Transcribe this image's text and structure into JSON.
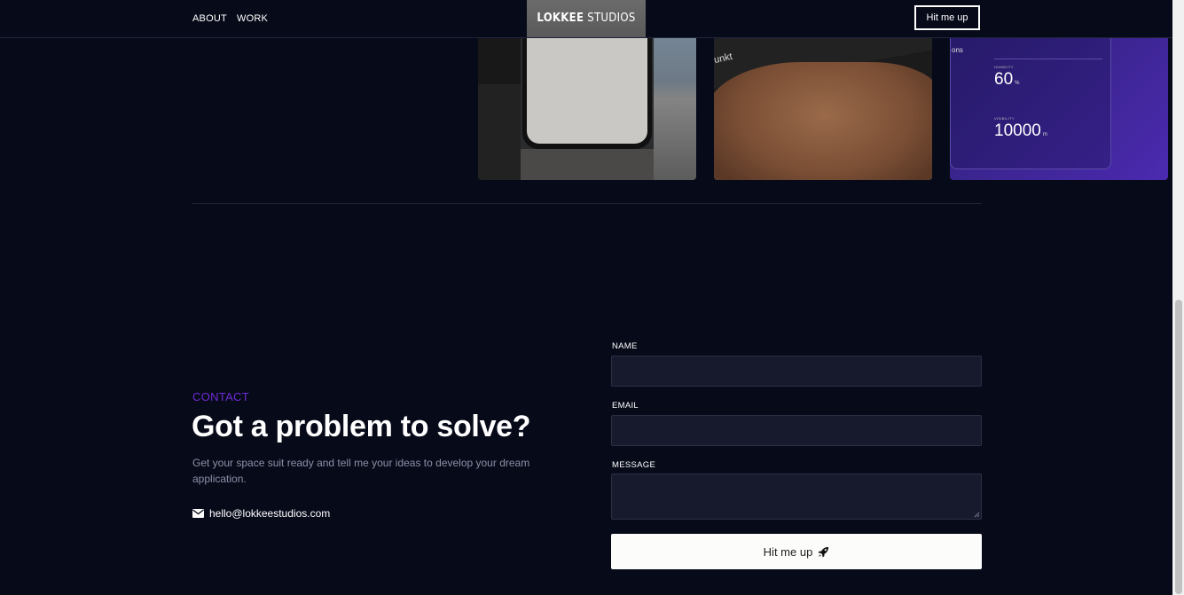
{
  "nav": {
    "links": [
      "ABOUT",
      "WORK"
    ],
    "brand_bold": "LOKKEE",
    "brand_light": "STUDIOS",
    "cta_label": "Hit me up"
  },
  "portfolio": {
    "hand_card_text": "unkt",
    "weather": {
      "tag": "ons",
      "humidity_label": "HUMIDITY",
      "humidity_value": "60",
      "humidity_unit": "%",
      "visibility_label": "VISIBILITY",
      "visibility_value": "10000",
      "visibility_unit": "m"
    }
  },
  "contact": {
    "eyebrow": "CONTACT",
    "headline": "Got a problem to solve?",
    "description": "Get your space suit ready and tell me your ideas to develop your dream application.",
    "email": "hello@lokkeestudios.com"
  },
  "form": {
    "name_label": "NAME",
    "name_value": "",
    "email_label": "EMAIL",
    "email_value": "",
    "message_label": "MESSAGE",
    "message_value": "",
    "submit_label": "Hit me up"
  },
  "colors": {
    "background": "#070a19",
    "accent": "#6f2bd6",
    "field_bg": "#161a2c",
    "button_bg": "#fcfcfb"
  },
  "icons": {
    "mail": "envelope-icon",
    "submit": "rocket-icon"
  }
}
